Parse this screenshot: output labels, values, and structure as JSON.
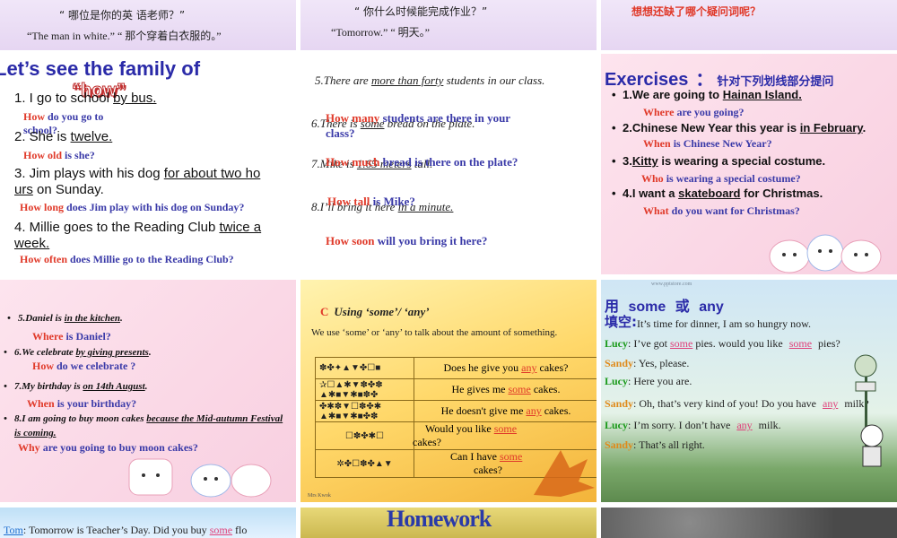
{
  "s1": {
    "line1": "“ 哪位是你的英 语老师？”",
    "line2": "“The man in white.” “ 那个穿着白衣服的。”"
  },
  "s2": {
    "line1": "“ 你什么时候能完成作业？”",
    "line2": "“Tomorrow.” “ 明天。”"
  },
  "s3": {
    "line1": "想想还缺了哪个疑问词呢？"
  },
  "s4": {
    "title": "Let’s see the family of",
    "title2": "“how”",
    "items": [
      {
        "pre": "1. I go to school ",
        "u": "by bus.",
        "post": ""
      },
      {
        "pre": "2. She is ",
        "u": "twelve.",
        "post": ""
      },
      {
        "pre": "3. Jim plays with his dog ",
        "u": "for about two ho",
        "post": ""
      },
      {
        "pre": "4. Millie goes to the Reading Club ",
        "u": "twice a",
        "post": ""
      }
    ],
    "item3_cont_u": "urs",
    "item3_cont": " on Sunday.",
    "item4_cont_u": "week.",
    "answers": [
      {
        "red": "How",
        "blue": " do you go to"
      },
      {
        "red": "",
        "blue": "school?"
      },
      {
        "red": "How old",
        "blue": " is she?"
      },
      {
        "red": "How long",
        "blue": " does Jim play with his dog on Sunday?"
      },
      {
        "red": "How often",
        "blue": " does Millie go to the Reading Club?"
      }
    ]
  },
  "s5": {
    "items": [
      {
        "pre": "5.There are ",
        "u": "more than forty",
        "post": " students in our class."
      },
      {
        "pre": "6.There is ",
        "u": "some",
        "post": " bread on the plate."
      },
      {
        "pre": "7.Mike is ",
        "u": "1.65 meters",
        "post": " tall."
      },
      {
        "pre": "8.I’ll bring it here ",
        "u": "in a minute.",
        "post": ""
      }
    ],
    "answers": [
      {
        "red": "How many",
        "blue": " students are there in your"
      },
      {
        "red": "",
        "blue": "class?"
      },
      {
        "red": "How much",
        "blue": " bread is there on the plate?"
      },
      {
        "red": "How tall",
        "blue": " is Mike?"
      },
      {
        "red": "How soon",
        "blue": " will you bring it here?"
      }
    ]
  },
  "s6": {
    "title": "Exercises",
    "colon": "：",
    "title_cn": "针对下列划线部分提问",
    "items": [
      {
        "pre": "1.We are going to ",
        "u": "Hainan Island.",
        "post": ""
      },
      {
        "pre": "2.Chinese New Year this year is ",
        "u": "in February",
        "post": "."
      },
      {
        "pre": "3.",
        "u": "Kitty",
        "post": " is wearing a special costume."
      },
      {
        "pre": "4.I want a ",
        "u": "skateboard",
        "post": " for Christmas."
      }
    ],
    "answers": [
      {
        "red": "Where",
        "blue": " are you going?"
      },
      {
        "red": "When",
        "blue": " is Chinese New Year?"
      },
      {
        "red": "Who",
        "blue": " is wearing a special costume?"
      },
      {
        "red": "What",
        "blue": " do you want for Christmas?"
      }
    ]
  },
  "s7": {
    "items": [
      {
        "pre": "5.Daniel is ",
        "u": "in the kitchen",
        "post": "."
      },
      {
        "pre": "6.We celebrate ",
        "u": "by giving presents",
        "post": "."
      },
      {
        "pre": "7.My birthday is ",
        "u": "on 14th August",
        "post": "."
      },
      {
        "pre": "8.I am going to buy moon cakes ",
        "u": "because the Mid-autumn Festival",
        "post": ""
      }
    ],
    "item8_cont_u": "is coming.",
    "answers": [
      {
        "red": "Where",
        "blue": " is Daniel?"
      },
      {
        "red": "How",
        "blue": " do we celebrate ?"
      },
      {
        "red": "When",
        "blue": " is your birthday?"
      },
      {
        "red": "Why",
        "blue": " are you going to buy moon cakes?"
      }
    ]
  },
  "s8": {
    "title_c": "C",
    "title": "Using ‘some’/ ‘any’",
    "subtitle": "We use ‘some’ or ‘any’ to talk about the amount of something.",
    "rows": [
      {
        "pre": "Does he give you ",
        "ans": "any",
        "post": " cakes?"
      },
      {
        "pre": "He gives me ",
        "ans": "some",
        "post": " cakes."
      },
      {
        "pre": "He doesn't give me ",
        "ans": "any",
        "post": " cakes."
      },
      {
        "pre": "Would you like ",
        "ans": "some",
        "post": ""
      },
      {
        "pre": "Can I have ",
        "ans": "some",
        "post": ""
      }
    ],
    "row4_cont": "cakes?",
    "row5_cont": "cakes?",
    "footer": "Mrs Kwok"
  },
  "s9": {
    "title_a": "用",
    "title_b": "some",
    "title_c": "或",
    "title_d": "any",
    "title_e": "填空:",
    "lines": [
      {
        "speaker": "Tom",
        "pre": "It’s time for dinner, I am so hungry now.",
        "ans": "",
        "post": "",
        "color": "#1e6fd0"
      },
      {
        "speaker": "Lucy",
        "pre": "I’ve got ",
        "ans": "some",
        "post": " pies. would you like ",
        "ans2": "some",
        "post2": " pies?",
        "color": "#1a9a1a"
      },
      {
        "speaker": "Sandy",
        "pre": "Yes, please.",
        "ans": "",
        "post": "",
        "color": "#e08a1a"
      },
      {
        "speaker": "Lucy",
        "pre": "Here you are.",
        "ans": "",
        "post": "",
        "color": "#1a9a1a"
      },
      {
        "speaker": "Sandy",
        "pre": "Oh, that’s very kind of you! Do you have ",
        "ans": "any",
        "post": " milk?",
        "color": "#e08a1a"
      },
      {
        "speaker": "Lucy",
        "pre": "I’m sorry. I don’t have ",
        "ans": "any",
        "post": " milk.",
        "color": "#1a9a1a"
      },
      {
        "speaker": "Sandy",
        "pre": "That’s all right.",
        "ans": "",
        "post": "",
        "color": "#e08a1a"
      }
    ],
    "watermark": "www.pptstore.com"
  },
  "s10": {
    "speaker": "Tom",
    "pre": "Tomorrow is Teacher’s Day. Did you buy ",
    "ans": "some",
    "post": " flo"
  },
  "s11": {
    "title": "Homework"
  }
}
